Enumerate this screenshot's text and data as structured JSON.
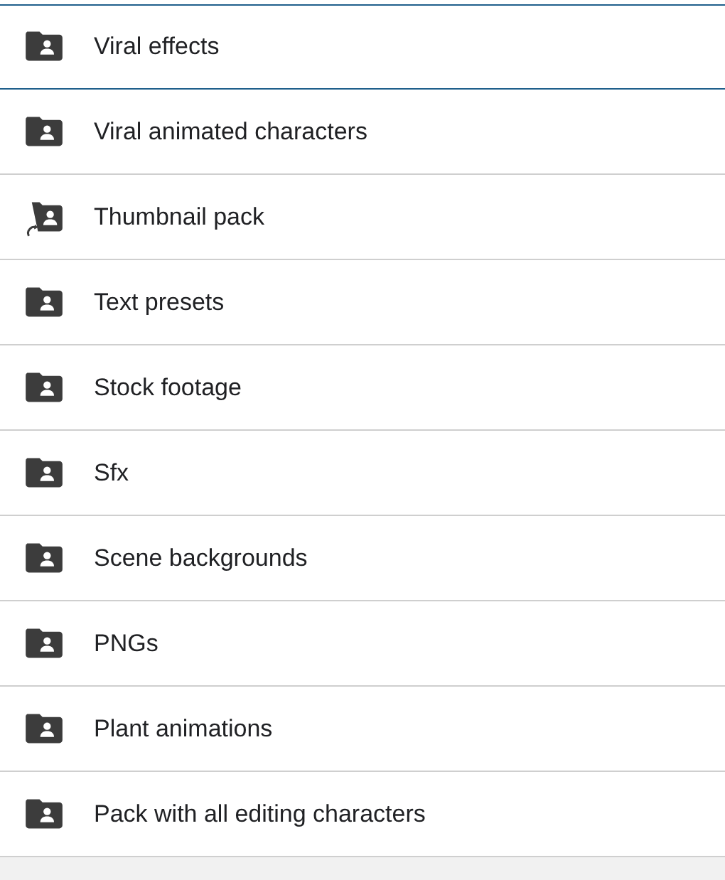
{
  "folders": [
    {
      "name": "Viral effects",
      "kind": "shared",
      "selected": true
    },
    {
      "name": "Viral animated characters",
      "kind": "shared",
      "selected": false
    },
    {
      "name": "Thumbnail pack",
      "kind": "shortcut",
      "selected": false
    },
    {
      "name": "Text presets",
      "kind": "shared",
      "selected": false
    },
    {
      "name": "Stock footage",
      "kind": "shared",
      "selected": false
    },
    {
      "name": "Sfx",
      "kind": "shared",
      "selected": false
    },
    {
      "name": "Scene backgrounds",
      "kind": "shared",
      "selected": false
    },
    {
      "name": "PNGs",
      "kind": "shared",
      "selected": false
    },
    {
      "name": "Plant animations",
      "kind": "shared",
      "selected": false
    },
    {
      "name": "Pack with all editing characters",
      "kind": "shared",
      "selected": false
    }
  ]
}
